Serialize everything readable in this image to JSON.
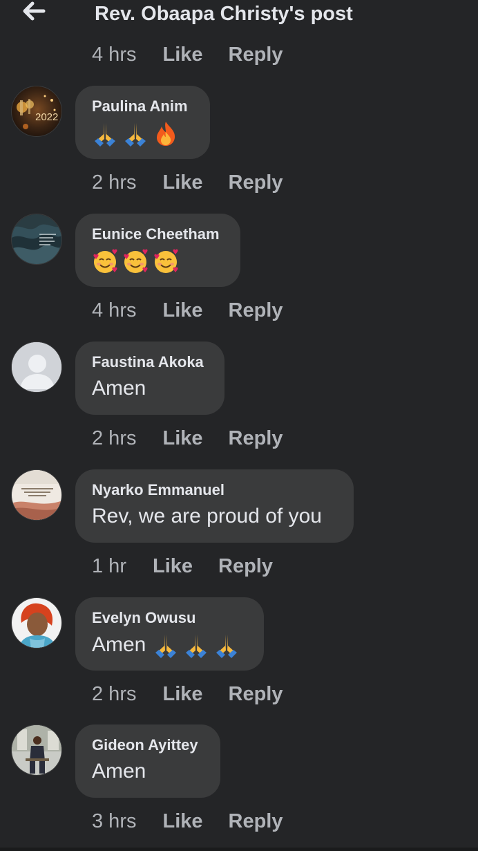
{
  "header": {
    "title": "Rev. Obaapa Christy's post"
  },
  "top_meta": {
    "time": "4 hrs",
    "like": "Like",
    "reply": "Reply"
  },
  "comments": [
    {
      "author": "Paulina Anim",
      "text": "",
      "emojis": [
        "folded-hands",
        "folded-hands",
        "fire"
      ],
      "avatar": "avatar-2022-celebration",
      "time": "2 hrs",
      "like": "Like",
      "reply": "Reply"
    },
    {
      "author": "Eunice Cheetham",
      "text": "",
      "emojis": [
        "smiling-face-with-hearts",
        "smiling-face-with-hearts",
        "smiling-face-with-hearts"
      ],
      "avatar": "avatar-ocean-wave",
      "time": "4 hrs",
      "like": "Like",
      "reply": "Reply"
    },
    {
      "author": "Faustina Akoka",
      "text": "Amen",
      "emojis": [],
      "avatar": "default-person-icon",
      "time": "2 hrs",
      "like": "Like",
      "reply": "Reply"
    },
    {
      "author": "Nyarko Emmanuel",
      "text": "Rev, we are proud of you",
      "emojis": [],
      "avatar": "avatar-quote-card",
      "time": "1 hr",
      "like": "Like",
      "reply": "Reply"
    },
    {
      "author": "Evelyn Owusu",
      "text": "Amen",
      "emojis": [
        "folded-hands",
        "folded-hands",
        "folded-hands"
      ],
      "avatar": "avatar-portrait-woman",
      "time": "2 hrs",
      "like": "Like",
      "reply": "Reply"
    },
    {
      "author": "Gideon Ayittey",
      "text": "Amen",
      "emojis": [],
      "avatar": "avatar-portrait-man-seated",
      "time": "3 hrs",
      "like": "Like",
      "reply": "Reply"
    }
  ],
  "colors": {
    "background": "#242527",
    "bubble": "#3a3b3c",
    "primary_text": "#e4e6eb",
    "secondary_text": "#b0b3b8"
  }
}
